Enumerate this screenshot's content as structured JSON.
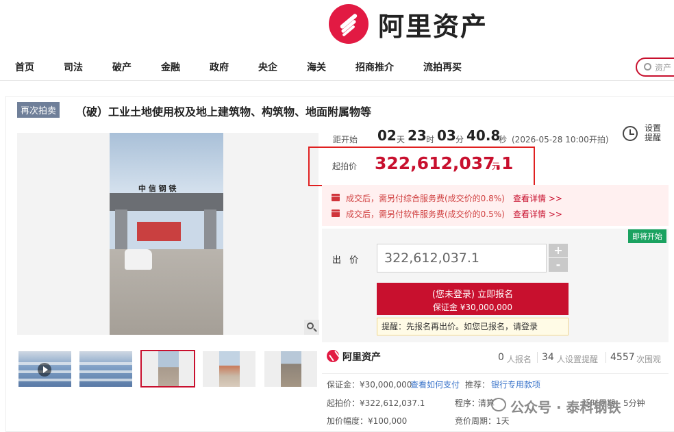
{
  "brand": {
    "name": "阿里资产",
    "color": "#e21a43"
  },
  "nav": {
    "items": [
      "首页",
      "司法",
      "破产",
      "金融",
      "政府",
      "央企",
      "海关",
      "招商推介",
      "流拍再买"
    ],
    "search_placeholder": "资产"
  },
  "auction": {
    "badge": "再次拍卖",
    "title": "（破）工业土地使用权及地上建筑物、构筑物、地面附属物等",
    "countdown": {
      "label": "距开始",
      "days": "02",
      "days_unit": "天",
      "hours": "23",
      "hours_unit": "时",
      "minutes": "03",
      "minutes_unit": "分",
      "seconds": "40.8",
      "seconds_unit": "秒",
      "start": "(2026-05-28 10:00开拍)"
    },
    "reminder": "设置提醒",
    "start_price_label": "起拍价",
    "start_price": "322,612,037.1",
    "currency": "元",
    "fees": [
      {
        "text": "成交后，需另付综合服务费(成交价的0.8%)",
        "link": "查看详情 >>"
      },
      {
        "text": "成交后，需另付软件服务费(成交价的0.5%)",
        "link": "查看详情 >>"
      }
    ],
    "status_tag": "即将开始",
    "bid_label": "出 价",
    "bid_value": "322,612,037.1",
    "plus": "+",
    "minus": "-",
    "signup_line1": "(您未登录) 立即报名",
    "signup_line2": "保证金 ¥30,000,000",
    "tip": "提醒：先报名再出价。如您已报名，请登录"
  },
  "photo": {
    "sign_text": "中 信 钢 铁"
  },
  "stats": {
    "signups": "0",
    "signups_label": "人报名",
    "reminders": "34",
    "reminders_label": "人设置提醒",
    "views": "4557",
    "views_label": "次围观"
  },
  "info": {
    "deposit": "保证金：¥30,000,000",
    "how_to_pay": "查看如何支付",
    "recommend": "推荐：",
    "bank_loan": "银行专用款项",
    "start_price": "起拍价：¥322,612,037.1",
    "procedure": "程序：",
    "procedure_val": "清算",
    "delay": "延时周期：5分钟",
    "increment": "加价幅度：¥100,000",
    "cycle": "竞价周期：1天"
  },
  "watermark": "公众号 · 泰科钢铁",
  "colors": {
    "accent": "#c8102e",
    "tag_green": "#1aa260",
    "badge": "#6f7f99",
    "link": "#3772c9"
  }
}
